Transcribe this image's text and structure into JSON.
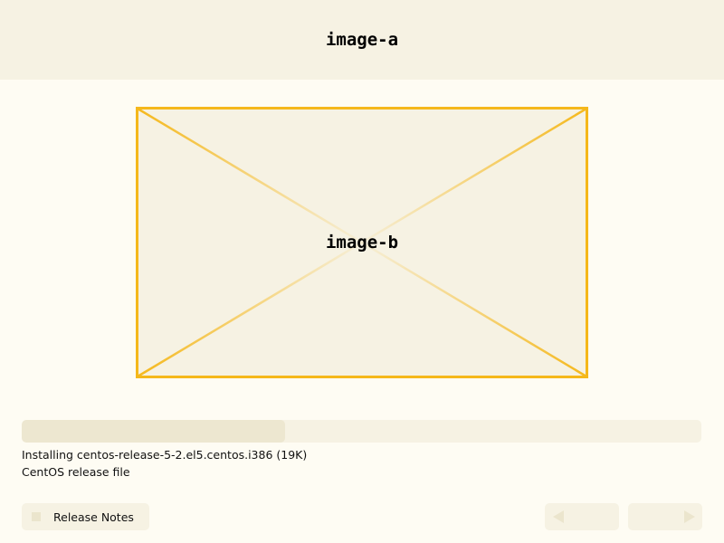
{
  "header": {
    "image_label": "image-a"
  },
  "main": {
    "image_label": "image-b"
  },
  "progress": {
    "fraction": 0.387
  },
  "status": {
    "package_line": "Installing centos-release-5-2.el5.centos.i386 (19K)",
    "description_line": "CentOS release file"
  },
  "footer": {
    "release_notes_label": "Release Notes",
    "back_icon": "triangle-left-icon",
    "next_icon": "triangle-right-icon"
  },
  "colors": {
    "header_bg": "#f6f2e3",
    "page_bg": "#fefcf3",
    "placeholder_border": "#f5b81b",
    "progress_fill": "#ede7d0"
  }
}
